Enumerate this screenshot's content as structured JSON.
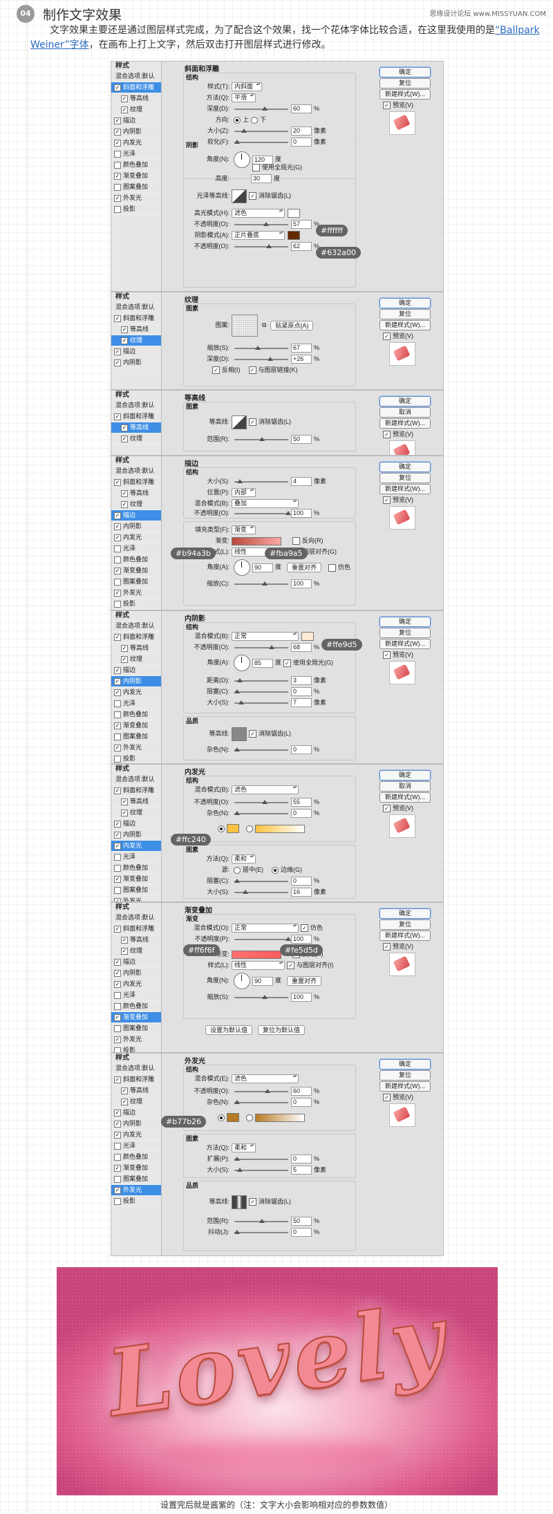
{
  "header": {
    "step": "04",
    "title": "制作文字效果",
    "site": "思缘设计论坛 www.MISSYUAN.COM"
  },
  "intro": {
    "part1": "文字效果主要还是通过图层样式完成，为了配合这个效果，找一个花体字体比较合适，在这里我使用的是",
    "font": "“Ballpark Weiner”字体",
    "part2": "，在画布上打上文字，然后双击打开图层样式进行修改。"
  },
  "sidebar": {
    "title": "样式",
    "items": [
      {
        "label": "混合选项:默认",
        "check": false,
        "sub": false,
        "head": true
      },
      {
        "label": "斜面和浮雕",
        "check": true,
        "sub": false
      },
      {
        "label": "等高线",
        "check": true,
        "sub": true
      },
      {
        "label": "纹理",
        "check": true,
        "sub": true
      },
      {
        "label": "描边",
        "check": true,
        "sub": false
      },
      {
        "label": "内阴影",
        "check": true,
        "sub": false
      },
      {
        "label": "内发光",
        "check": true,
        "sub": false
      },
      {
        "label": "光泽",
        "check": false,
        "sub": false
      },
      {
        "label": "颜色叠加",
        "check": false,
        "sub": false
      },
      {
        "label": "渐变叠加",
        "check": true,
        "sub": false
      },
      {
        "label": "图案叠加",
        "check": false,
        "sub": false
      },
      {
        "label": "外发光",
        "check": true,
        "sub": false
      },
      {
        "label": "投影",
        "check": false,
        "sub": false
      }
    ]
  },
  "buttons": {
    "ok": "确定",
    "reset": "复位",
    "cancel": "取消",
    "new_style": "新建样式(W)...",
    "preview": "预览(V)"
  },
  "bevel": {
    "title": "斜面和浮雕",
    "struct": "结构",
    "style_l": "样式(T):",
    "style_v": "内斜面",
    "tech_l": "方法(Q):",
    "tech_v": "平滑",
    "depth_l": "深度(D):",
    "depth_v": "60",
    "dir_l": "方向:",
    "up": "上",
    "down": "下",
    "size_l": "大小(Z):",
    "size_v": "20",
    "soft_l": "软化(F):",
    "soft_v": "0",
    "shade": "阴影",
    "angle_l": "角度(N):",
    "angle_v": "120",
    "deg": "度",
    "global": "使用全局光(G)",
    "alt_l": "高度:",
    "alt_v": "30",
    "gloss_l": "光泽等高线:",
    "anti": "消除锯齿(L)",
    "hl_l": "高光模式(H):",
    "hl_v": "滤色",
    "hl_op_v": "57",
    "sh_l": "阴影模式(A):",
    "sh_v": "正片叠底",
    "sh_op_v": "62",
    "op_l": "不透明度(O):",
    "tag1": "#ffffff",
    "tag2": "#632a00",
    "c1": "#ffffff",
    "c2": "#632a00"
  },
  "texture": {
    "title": "纹理",
    "sec": "图素",
    "pat_l": "图案:",
    "snap": "贴紧原点(A)",
    "scale_l": "缩放(S):",
    "scale_v": "67",
    "depth_l": "深度(D):",
    "depth_v": "+26",
    "invert": "反相(I)",
    "link": "与图层链接(K)"
  },
  "contour": {
    "title": "等高线",
    "sec": "图素",
    "c_l": "等高线:",
    "anti": "消除锯齿(L)",
    "range_l": "范围(R):",
    "range_v": "50"
  },
  "stroke": {
    "title": "描边",
    "struct": "结构",
    "size_l": "大小(S):",
    "size_v": "4",
    "pos_l": "位置(P):",
    "pos_v": "内部",
    "blend_l": "混合模式(B):",
    "blend_v": "叠加",
    "op_l": "不透明度(O):",
    "op_v": "100",
    "fill_l": "填充类型(F):",
    "fill_v": "渐变",
    "grad_l": "渐变:",
    "rev": "反向(R)",
    "style_l": "样式(L):",
    "style_v": "线性",
    "align": "与图层对齐(G)",
    "angle_l": "角度(A):",
    "angle_v": "90",
    "reset_align": "重置对齐",
    "dither": "仿色",
    "scale_l": "缩放(C):",
    "scale_v": "100",
    "tag1": "#b94a3b",
    "tag2": "#fba9a5",
    "c1": "#b94a3b",
    "c2": "#fba9a5"
  },
  "inner_shadow": {
    "title": "内阴影",
    "struct": "结构",
    "blend_l": "混合模式(B):",
    "blend_v": "正常",
    "op_l": "不透明度(O):",
    "op_v": "68",
    "angle_l": "角度(A):",
    "angle_v": "85",
    "global": "使用全局光(G)",
    "dist_l": "距离(D):",
    "dist_v": "3",
    "choke_l": "阻塞(C):",
    "choke_v": "0",
    "size_l": "大小(S):",
    "size_v": "7",
    "quality": "品质",
    "c_l": "等高线:",
    "anti": "消除锯齿(L)",
    "noise_l": "杂色(N):",
    "noise_v": "0",
    "tag": "#ffe9d5",
    "c": "#ffe9d5"
  },
  "inner_glow": {
    "title": "内发光",
    "struct": "结构",
    "blend_l": "混合模式(B):",
    "blend_v": "滤色",
    "op_l": "不透明度(O):",
    "op_v": "55",
    "noise_l": "杂色(N):",
    "noise_v": "0",
    "sec": "图素",
    "tech_l": "方法(Q):",
    "tech_v": "柔和",
    "src_l": "源:",
    "center": "居中(E)",
    "edge": "边缘(G)",
    "choke_l": "阻塞(C):",
    "choke_v": "0",
    "size_l": "大小(S):",
    "size_v": "16",
    "tag": "#ffc240",
    "c": "#ffc240"
  },
  "grad_overlay": {
    "title": "渐变叠加",
    "sec": "渐变",
    "blend_l": "混合模式(O):",
    "blend_v": "正常",
    "dither": "仿色",
    "op_l": "不透明度(P):",
    "op_v": "100",
    "grad_l": "渐变:",
    "rev": "反向(R)",
    "style_l": "样式(L):",
    "style_v": "线性",
    "align": "与图层对齐(I)",
    "angle_l": "角度(N):",
    "angle_v": "90",
    "reset_align": "重置对齐",
    "scale_l": "缩放(S):",
    "scale_v": "100",
    "def1": "设置为默认值",
    "def2": "复位为默认值",
    "tag1": "#ff6f6f",
    "tag2": "#fe5d5d",
    "c1": "#ff6f6f",
    "c2": "#fe5d5d"
  },
  "outer_glow": {
    "title": "外发光",
    "struct": "结构",
    "blend_l": "混合模式(E):",
    "blend_v": "滤色",
    "op_l": "不透明度(O):",
    "op_v": "60",
    "noise_l": "杂色(N):",
    "noise_v": "0",
    "sec": "图素",
    "tech_l": "方法(Q):",
    "tech_v": "柔和",
    "spread_l": "扩展(P):",
    "spread_v": "0",
    "size_l": "大小(S):",
    "size_v": "5",
    "quality": "品质",
    "c_l": "等高线:",
    "anti": "消除锯齿(L)",
    "range_l": "范围(R):",
    "range_v": "50",
    "jitter_l": "抖动(J):",
    "jitter_v": "0",
    "tag": "#b77b26",
    "c": "#b77b26"
  },
  "units": {
    "pct": "%",
    "px": "像素",
    "deg": "度"
  },
  "final": {
    "text": "Lovely",
    "caption": "设置完后就是酱紫的（注：文字大小会影响相对应的参数数值）"
  }
}
